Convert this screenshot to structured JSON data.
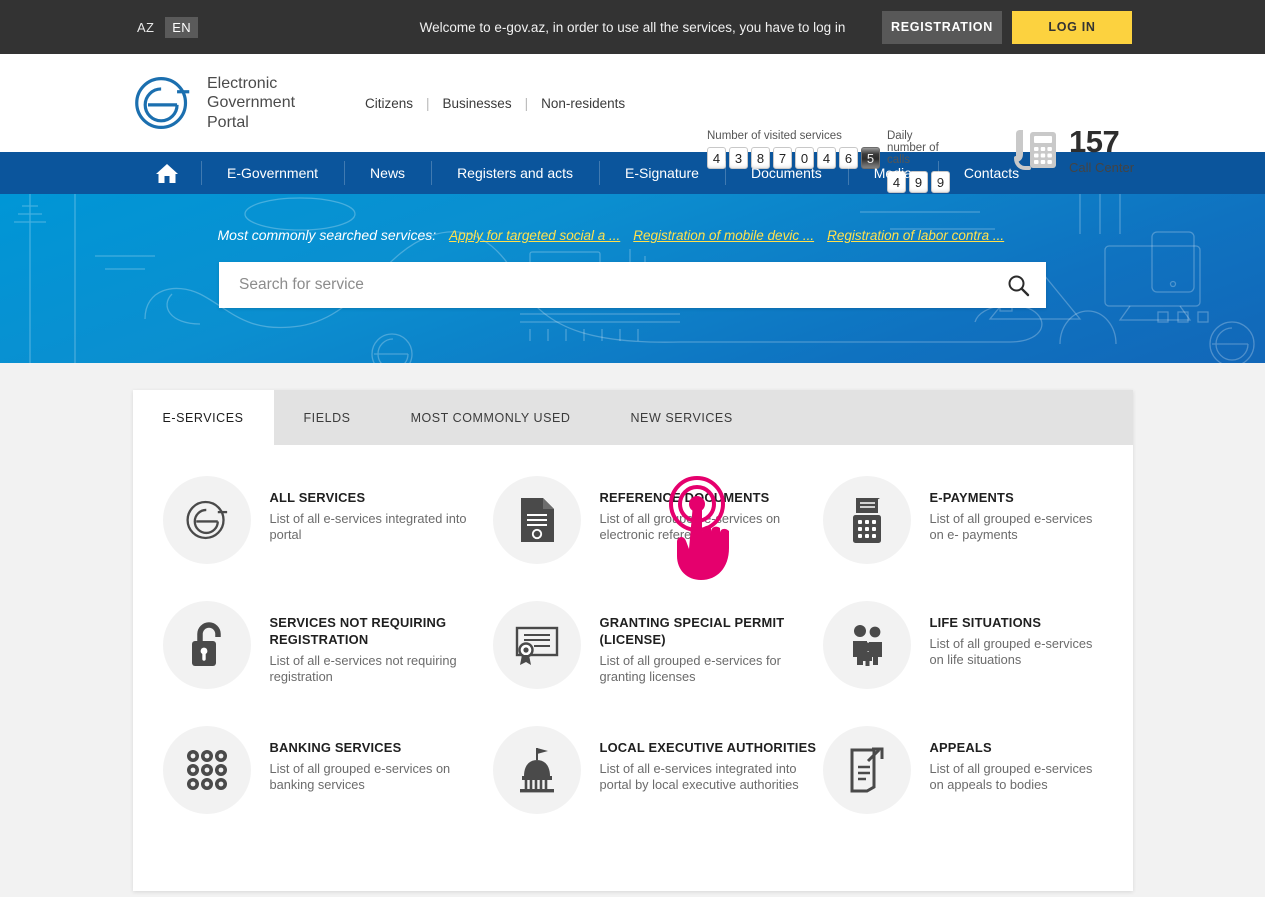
{
  "topbar": {
    "languages": [
      {
        "code": "AZ",
        "active": false
      },
      {
        "code": "EN",
        "active": true
      }
    ],
    "welcome_message": "Welcome to e-gov.az, in order to use all the services, you have to log in",
    "registration_label": "REGISTRATION",
    "login_label": "LOG IN"
  },
  "header": {
    "logo_line1": "Electronic",
    "logo_line2": "Government",
    "logo_line3": "Portal",
    "audience_nav": [
      {
        "label": "Citizens"
      },
      {
        "label": "Businesses"
      },
      {
        "label": "Non-residents"
      }
    ],
    "separator": "|",
    "counters": [
      {
        "label": "Number of visited services",
        "digits": [
          "4",
          "3",
          "8",
          "7",
          "0",
          "4",
          "6",
          "5"
        ],
        "rolling_index": 7
      },
      {
        "label": "Daily number of calls",
        "digits": [
          "4",
          "9",
          "9"
        ],
        "rolling_index": -1
      }
    ],
    "call_center": {
      "number": "157",
      "caption": "Call Center"
    }
  },
  "main_nav": {
    "home_icon": "home-icon",
    "items": [
      {
        "label": "E-Government"
      },
      {
        "label": "News"
      },
      {
        "label": "Registers and acts"
      },
      {
        "label": "E-Signature"
      },
      {
        "label": "Documents"
      },
      {
        "label": "Media"
      },
      {
        "label": "Contacts"
      }
    ]
  },
  "hero": {
    "popular_label": "Most commonly searched services:",
    "popular_links": [
      {
        "label": "Apply for targeted social a ..."
      },
      {
        "label": "Registration of mobile devic ..."
      },
      {
        "label": "Registration of labor contra ..."
      }
    ],
    "search": {
      "value": "",
      "placeholder": "Search for service",
      "icon": "search-icon"
    }
  },
  "panel": {
    "tabs": [
      {
        "label": "E-SERVICES",
        "active": true
      },
      {
        "label": "FIELDS",
        "active": false
      },
      {
        "label": "MOST COMMONLY USED",
        "active": false
      },
      {
        "label": "NEW SERVICES",
        "active": false
      }
    ],
    "cards": [
      {
        "icon": "e-portal-icon",
        "title": "ALL SERVICES",
        "desc": "List of all e-services integrated into portal"
      },
      {
        "icon": "document-icon",
        "title": "REFERENCE DOCUMENTS",
        "desc": "List of all grouped e-services on electronic references"
      },
      {
        "icon": "payment-terminal-icon",
        "title": "E-PAYMENTS",
        "desc": "List of all grouped e-services on e- payments"
      },
      {
        "icon": "open-padlock-icon",
        "title": "SERVICES NOT REQUIRING REGISTRATION",
        "desc": "List of all e-services not requiring registration"
      },
      {
        "icon": "certificate-icon",
        "title": "GRANTING SPECIAL PERMIT (LICENSE)",
        "desc": "List of all grouped e-services for granting licenses"
      },
      {
        "icon": "family-icon",
        "title": "LIFE SITUATIONS",
        "desc": "List of all grouped e-services on life situations"
      },
      {
        "icon": "grid-dots-icon",
        "title": "BANKING SERVICES",
        "desc": "List of all grouped e-services on banking services"
      },
      {
        "icon": "capitol-building-icon",
        "title": "LOCAL EXECUTIVE AUTHORITIES",
        "desc": "List of all e-services integrated into portal by local executive authorities"
      },
      {
        "icon": "appeal-document-icon",
        "title": "APPEALS",
        "desc": "List of all grouped e-services on appeals to bodies"
      }
    ]
  },
  "cursor": {
    "icon": "click-hand-cursor",
    "color": "#e5006d"
  },
  "colors": {
    "topbar_bg": "#333333",
    "nav_blue": "#0b559c",
    "hero_blue": "#0b8fd0",
    "accent_yellow": "#fcd23f",
    "link_yellow": "#ffe14d",
    "page_bg": "#f2f2f2",
    "icon_gray": "#4a4a4a",
    "cursor_pink": "#e5006d"
  }
}
